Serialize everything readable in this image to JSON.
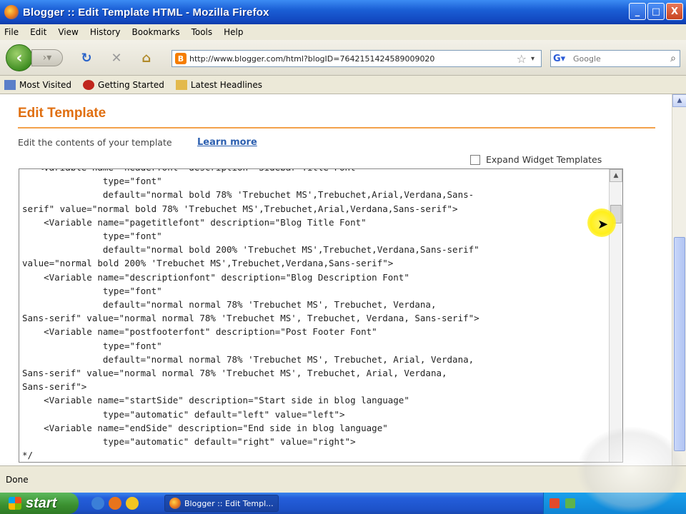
{
  "window": {
    "title": "Blogger :: Edit Template HTML - Mozilla Firefox",
    "controls": [
      "_",
      "□",
      "X"
    ]
  },
  "menu": [
    "File",
    "Edit",
    "View",
    "History",
    "Bookmarks",
    "Tools",
    "Help"
  ],
  "nav": {
    "url": "http://www.blogger.com/html?blogID=7642151424589009020",
    "search_placeholder": "Google"
  },
  "bookmarks": [
    "Most Visited",
    "Getting Started",
    "Latest Headlines"
  ],
  "page": {
    "title": "Edit Template",
    "description": "Edit the contents of your template",
    "learn_more": "Learn more",
    "expand_widget": "Expand Widget Templates"
  },
  "code_lines": [
    "   <Variable name=\"headerfont\" description=\"Sidebar Title Font\"",
    "               type=\"font\"",
    "               default=\"normal bold 78% 'Trebuchet MS',Trebuchet,Arial,Verdana,Sans-",
    "serif\" value=\"normal bold 78% 'Trebuchet MS',Trebuchet,Arial,Verdana,Sans-serif\">",
    "    <Variable name=\"pagetitlefont\" description=\"Blog Title Font\"",
    "               type=\"font\"",
    "               default=\"normal bold 200% 'Trebuchet MS',Trebuchet,Verdana,Sans-serif\"",
    "value=\"normal bold 200% 'Trebuchet MS',Trebuchet,Verdana,Sans-serif\">",
    "    <Variable name=\"descriptionfont\" description=\"Blog Description Font\"",
    "               type=\"font\"",
    "               default=\"normal normal 78% 'Trebuchet MS', Trebuchet, Verdana,",
    "Sans-serif\" value=\"normal normal 78% 'Trebuchet MS', Trebuchet, Verdana, Sans-serif\">",
    "    <Variable name=\"postfooterfont\" description=\"Post Footer Font\"",
    "               type=\"font\"",
    "               default=\"normal normal 78% 'Trebuchet MS', Trebuchet, Arial, Verdana,",
    "Sans-serif\" value=\"normal normal 78% 'Trebuchet MS', Trebuchet, Arial, Verdana,",
    "Sans-serif\">",
    "    <Variable name=\"startSide\" description=\"Start side in blog language\"",
    "               type=\"automatic\" default=\"left\" value=\"left\">",
    "    <Variable name=\"endSide\" description=\"End side in blog language\"",
    "               type=\"automatic\" default=\"right\" value=\"right\">",
    "*/"
  ],
  "status": "Done",
  "taskbar": {
    "start": "start",
    "task": "Blogger :: Edit Templ..."
  }
}
